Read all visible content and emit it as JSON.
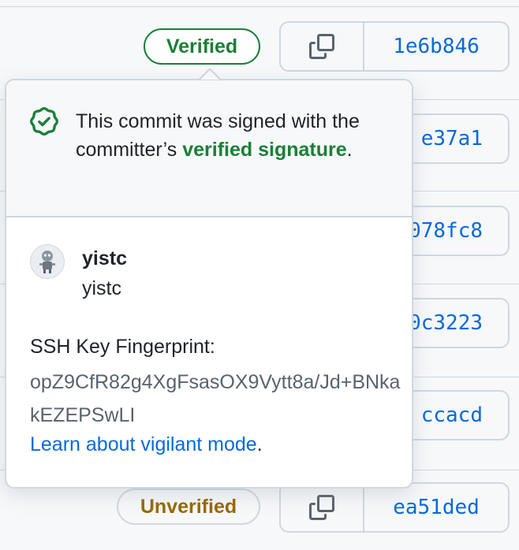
{
  "rows": [
    {
      "badge": "Verified",
      "sha": "1e6b846"
    },
    {
      "sha_partial": "e37a1"
    },
    {
      "sha_partial": "078fc8"
    },
    {
      "sha_partial": "0c3223"
    },
    {
      "sha_partial": "ccacd"
    },
    {
      "badge": "Unverified",
      "sha": "ea51ded"
    }
  ],
  "popover": {
    "message_prefix": "This commit was signed with the committer’s ",
    "message_highlight": "verified signature",
    "message_suffix": ".",
    "user_login": "yistc",
    "user_name": "yistc",
    "ssh_label": "SSH Key Fingerprint:",
    "ssh_fingerprint": "opZ9CfR82g4XgFsasOX9Vytt8a/Jd+BNkakEZEPSwLI",
    "learn_link": "Learn about vigilant mode",
    "learn_suffix": "."
  },
  "colors": {
    "verified": "#1a7f37",
    "unverified": "#9a6700",
    "link": "#0969da"
  },
  "icons": [
    "copy-icon",
    "shield-check-icon",
    "avatar-robot"
  ]
}
